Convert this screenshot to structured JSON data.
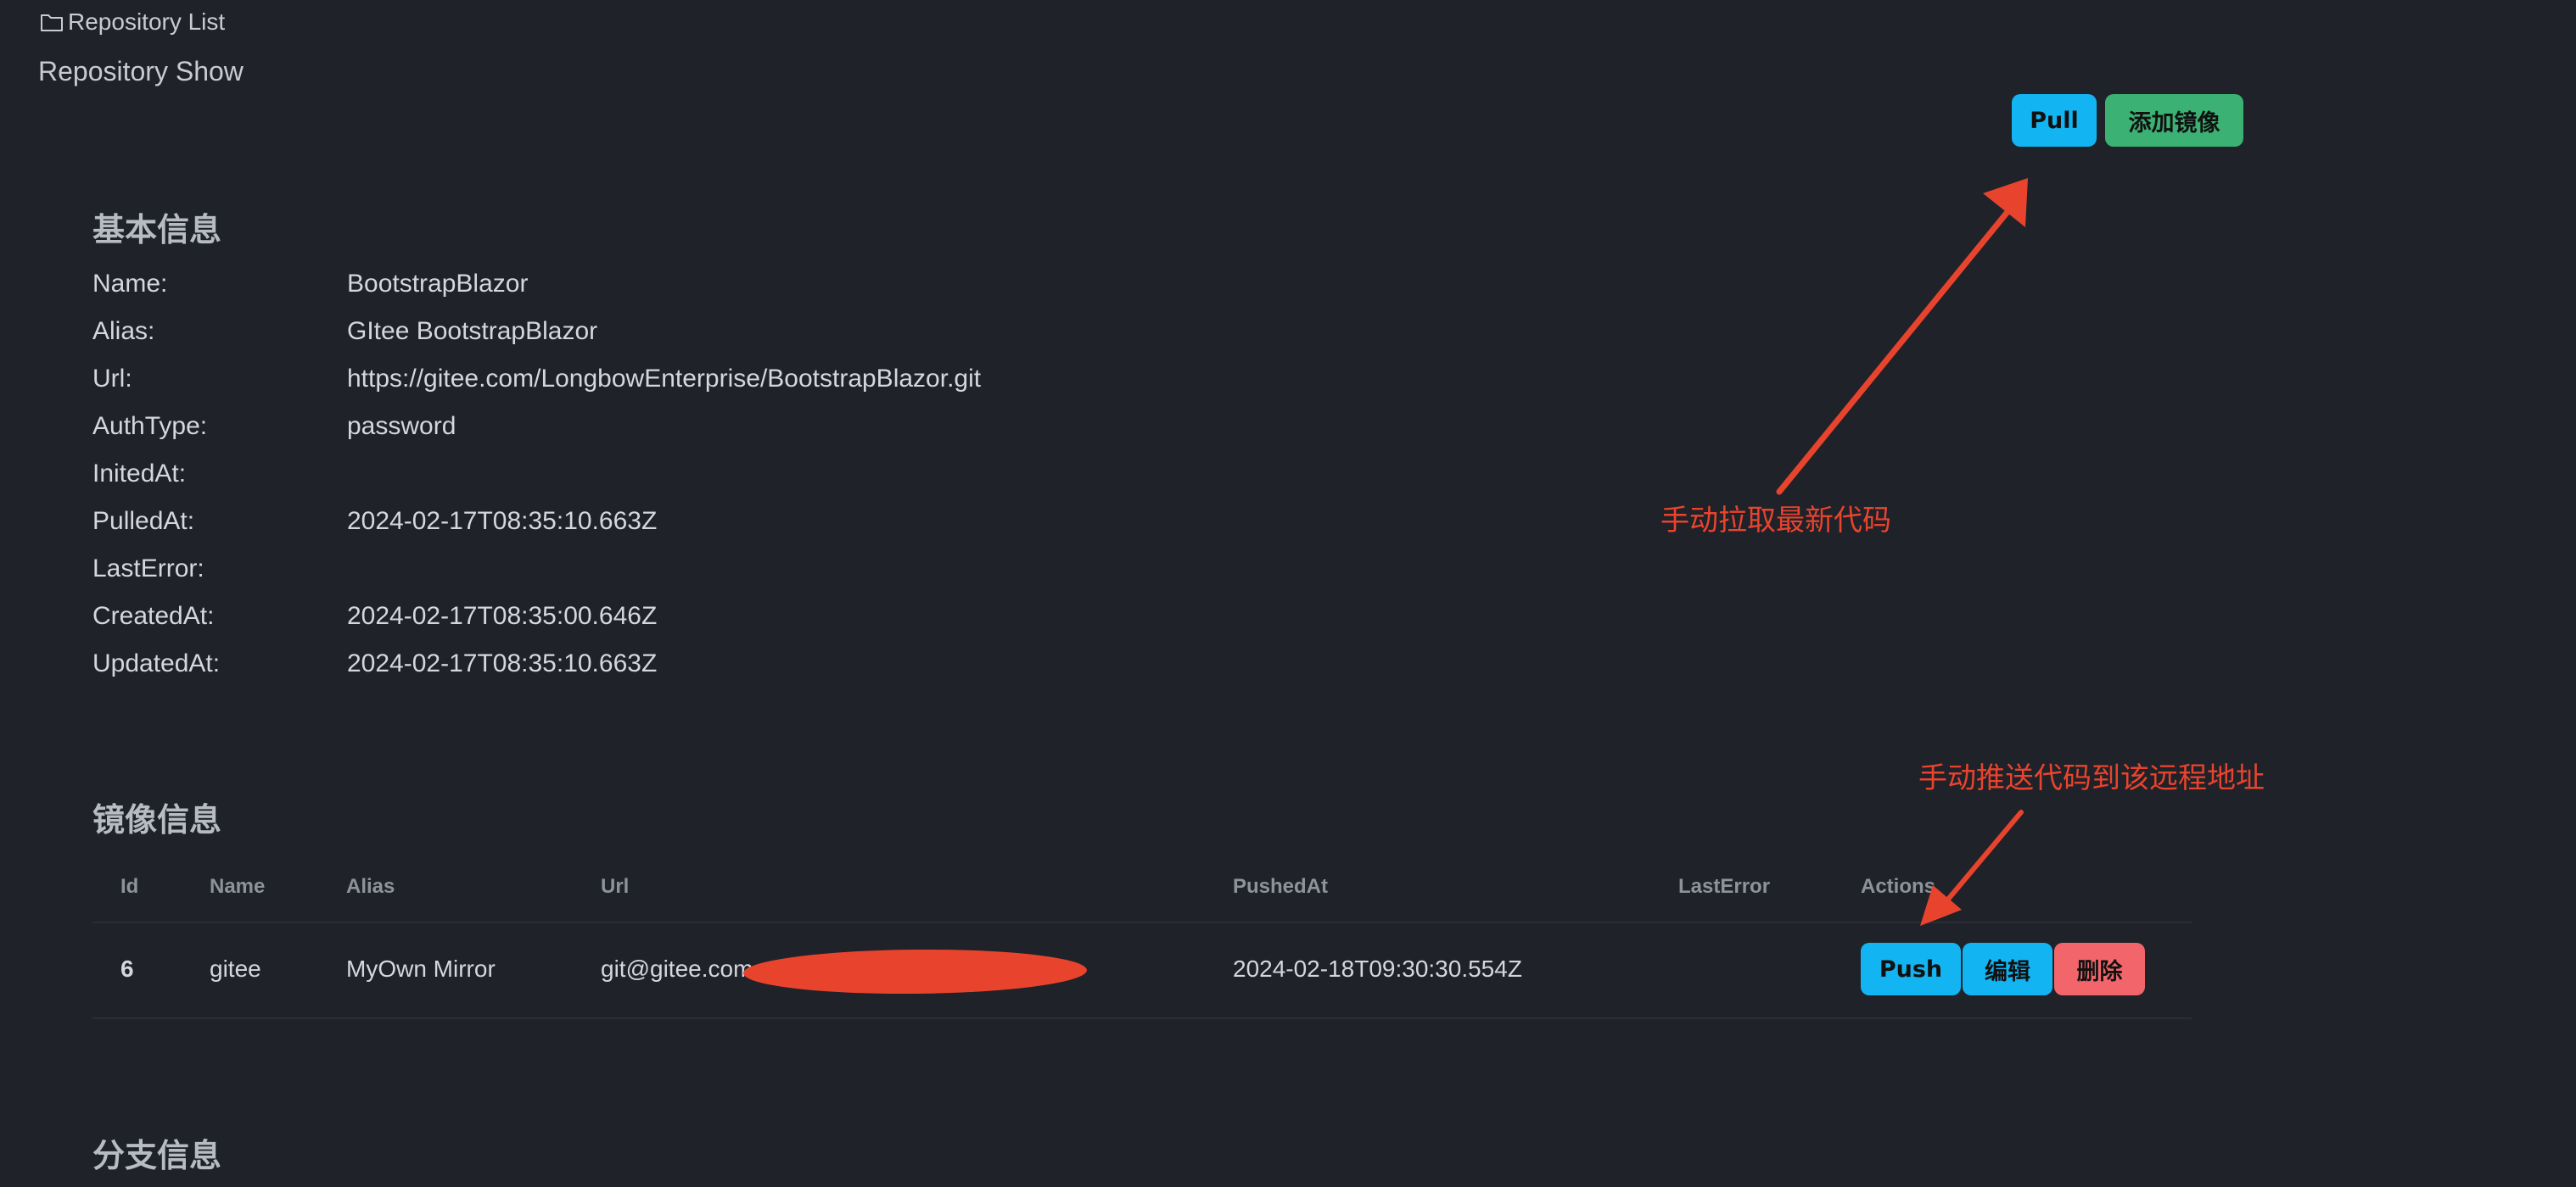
{
  "breadcrumb": {
    "link_label": "Repository List",
    "icon": "folder-icon"
  },
  "page": {
    "title": "Repository Show"
  },
  "toolbar": {
    "pull_label": "Pull",
    "add_mirror_label": "添加镜像"
  },
  "basic_info": {
    "title": "基本信息",
    "rows": [
      {
        "label": "Name:",
        "value": "BootstrapBlazor"
      },
      {
        "label": "Alias:",
        "value": "GItee BootstrapBlazor"
      },
      {
        "label": "Url:",
        "value": "https://gitee.com/LongbowEnterprise/BootstrapBlazor.git"
      },
      {
        "label": "AuthType:",
        "value": "password"
      },
      {
        "label": "InitedAt:",
        "value": ""
      },
      {
        "label": "PulledAt:",
        "value": "2024-02-17T08:35:10.663Z"
      },
      {
        "label": "LastError:",
        "value": ""
      },
      {
        "label": "CreatedAt:",
        "value": "2024-02-17T08:35:00.646Z"
      },
      {
        "label": "UpdatedAt:",
        "value": "2024-02-17T08:35:10.663Z"
      }
    ]
  },
  "mirror_info": {
    "title": "镜像信息",
    "headers": [
      "Id",
      "Name",
      "Alias",
      "Url",
      "PushedAt",
      "LastError",
      "Actions"
    ],
    "rows": [
      {
        "id": "6",
        "name": "gitee",
        "alias": "MyOwn Mirror",
        "url": "git@gitee.com",
        "pushed_at": "2024-02-18T09:30:30.554Z",
        "last_error": "",
        "actions": {
          "push": "Push",
          "edit": "编辑",
          "delete": "删除"
        }
      }
    ]
  },
  "branch_info": {
    "title": "分支信息"
  },
  "annotations": {
    "pull_note": "手动拉取最新代码",
    "push_note": "手动推送代码到该远程地址"
  },
  "colors": {
    "background": "#1f2229",
    "primary": "#12b5f2",
    "success": "#3bb273",
    "danger": "#f2666b",
    "annotation": "#e8442d"
  }
}
